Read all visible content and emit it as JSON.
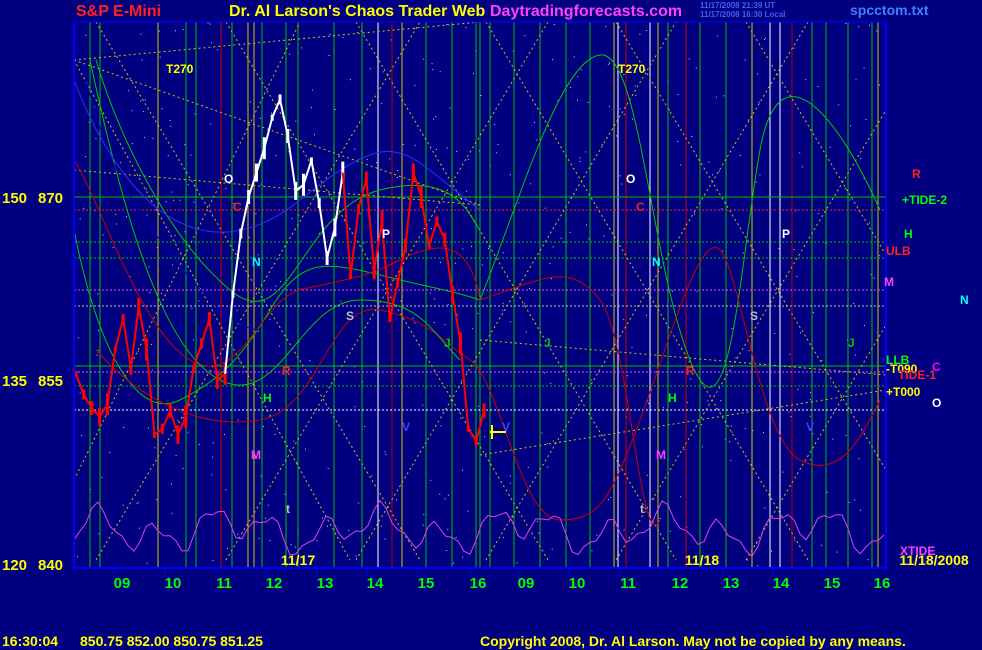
{
  "header": {
    "symbol": "S&P E-Mini",
    "title": "Dr. Al Larson's Chaos Trader Web",
    "site": "Daytradingforecasts.com",
    "stamp1": "11/17/2008 21:39 UT",
    "stamp2": "11/17/2008 16:30 Local",
    "filename": "spcctom.txt"
  },
  "footer": {
    "time": "16:30:04",
    "quote": "850.75 852.00 850.75 851.25",
    "copyright": "Copyright 2008, Dr. Al Larson. May not be copied by any means."
  },
  "colors": {
    "background": "#000080",
    "axis": "#0000ff",
    "price": "#ff0000",
    "price_highlight": "#ffffff",
    "forecast_green": "#00c800",
    "forecast_red": "#c80000",
    "xtide": "#e040e0",
    "gann_yellow": "#ffff00",
    "label_yellow": "#ffff00"
  },
  "chart_data": {
    "type": "line",
    "title": "S&P E-Mini",
    "y_left_outer": [
      "150",
      "135",
      "120"
    ],
    "y_left_inner": [
      "870",
      "855",
      "840"
    ],
    "ylim": [
      840,
      880
    ],
    "x_ticks": [
      "09",
      "10",
      "11",
      "12",
      "13",
      "14",
      "15",
      "16",
      "09",
      "10",
      "11",
      "12",
      "13",
      "14",
      "15",
      "16"
    ],
    "day_labels": [
      "11/17",
      "11/18",
      "11/18/2008"
    ],
    "series": [
      {
        "values": [
          855.5,
          853.8,
          852.7,
          852.0,
          853.0,
          857.5,
          860.0,
          856.0,
          861.0,
          857.5,
          850.5,
          851.0,
          852.5,
          850.5,
          852.0,
          856.0,
          858.0,
          860.0,
          855.0,
          855.5,
          862.0,
          867.0,
          870.0,
          872.0,
          874.0,
          876.5,
          878.0,
          875.0,
          870.5,
          871.0,
          873.0,
          869.5,
          865.0,
          867.5,
          872.0,
          863.5,
          869.0,
          871.5,
          864.0,
          868.0,
          860.0,
          863.0,
          866.0,
          872.0,
          870.0,
          866.0,
          868.0,
          866.5,
          862.0,
          858.0,
          851.0,
          850.0,
          852.5
        ]
      }
    ],
    "annotations": [
      {
        "text": "T270",
        "color": "#ffff00"
      },
      {
        "text": "T270",
        "color": "#ffff00"
      },
      {
        "text": "O",
        "color": "#ffffff"
      },
      {
        "text": "O",
        "color": "#ffffff"
      },
      {
        "text": "O",
        "color": "#ffffff"
      },
      {
        "text": "C",
        "color": "#ff2020"
      },
      {
        "text": "C",
        "color": "#ff2020"
      },
      {
        "text": "C",
        "color": "#ff00ff"
      },
      {
        "text": "N",
        "color": "#00ffff"
      },
      {
        "text": "N",
        "color": "#00ffff"
      },
      {
        "text": "N",
        "color": "#00ffff"
      },
      {
        "text": "R",
        "color": "#ff2020"
      },
      {
        "text": "R",
        "color": "#ff2020"
      },
      {
        "text": "R",
        "color": "#ff2020"
      },
      {
        "text": "H",
        "color": "#00ff00"
      },
      {
        "text": "H",
        "color": "#00ff00"
      },
      {
        "text": "H",
        "color": "#00ff00"
      },
      {
        "text": "M",
        "color": "#ff40ff"
      },
      {
        "text": "M",
        "color": "#ff40ff"
      },
      {
        "text": "M",
        "color": "#ff40ff"
      },
      {
        "text": "S",
        "color": "#c0c0c0"
      },
      {
        "text": "S",
        "color": "#c0c0c0"
      },
      {
        "text": "P",
        "color": "#ffffff"
      },
      {
        "text": "P",
        "color": "#ffffff"
      },
      {
        "text": "J",
        "color": "#00c000"
      },
      {
        "text": "J",
        "color": "#00c000"
      },
      {
        "text": "J",
        "color": "#00c000"
      },
      {
        "text": "V",
        "color": "#4040ff"
      },
      {
        "text": "V",
        "color": "#4040ff"
      },
      {
        "text": "V",
        "color": "#4040ff"
      },
      {
        "text": "t",
        "color": "#c0c0c0"
      },
      {
        "text": "t",
        "color": "#c0c0c0"
      },
      {
        "text": "+TIDE-2",
        "color": "#00ff00"
      },
      {
        "text": "ULB",
        "color": "#ff2020"
      },
      {
        "text": "LLB",
        "color": "#00ff00"
      },
      {
        "text": "-T090",
        "color": "#ffff00"
      },
      {
        "text": "TIDE-1",
        "color": "#ff2020"
      },
      {
        "text": "+T000",
        "color": "#ffff00"
      },
      {
        "text": "XTIDE",
        "color": "#ff40ff"
      }
    ]
  }
}
